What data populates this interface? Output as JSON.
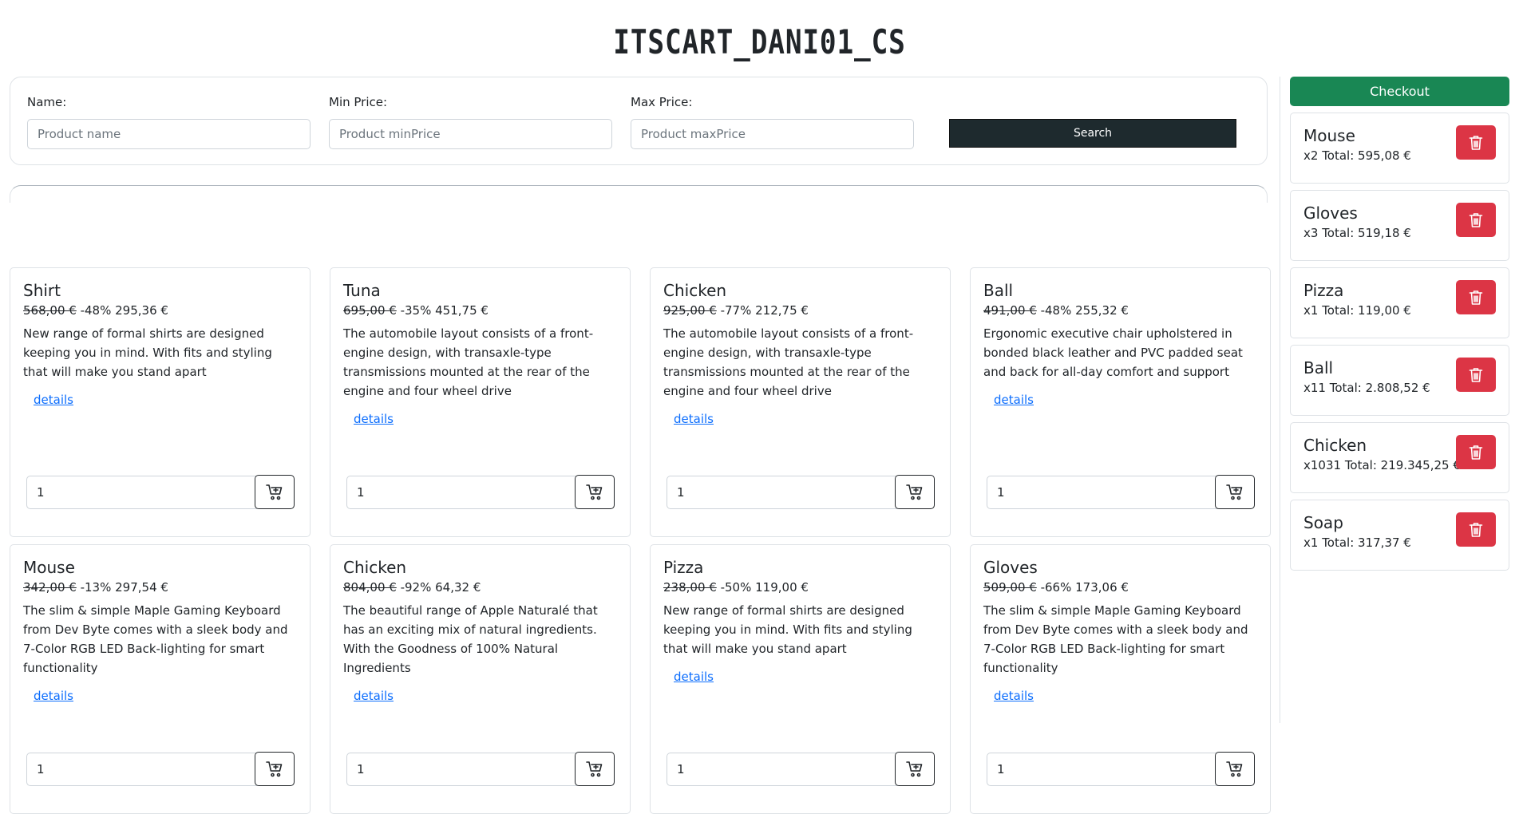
{
  "header": {
    "title": "ITSCART_DANI01_CS"
  },
  "search": {
    "name_label": "Name:",
    "name_placeholder": "Product name",
    "min_label": "Min Price:",
    "min_placeholder": "Product minPrice",
    "max_label": "Max Price:",
    "max_placeholder": "Product maxPrice",
    "button_label": "Search"
  },
  "products": [
    {
      "name": "Shirt",
      "old_price": "568,00 €",
      "discount": "-48%",
      "price": "295,36 €",
      "description": "New range of formal shirts are designed keeping you in mind. With fits and styling that will make you stand apart",
      "details_label": "details",
      "qty": "1"
    },
    {
      "name": "Tuna",
      "old_price": "695,00 €",
      "discount": "-35%",
      "price": "451,75 €",
      "description": "The automobile layout consists of a front-engine design, with transaxle-type transmissions mounted at the rear of the engine and four wheel drive",
      "details_label": "details",
      "qty": "1"
    },
    {
      "name": "Chicken",
      "old_price": "925,00 €",
      "discount": "-77%",
      "price": "212,75 €",
      "description": "The automobile layout consists of a front-engine design, with transaxle-type transmissions mounted at the rear of the engine and four wheel drive",
      "details_label": "details",
      "qty": "1"
    },
    {
      "name": "Ball",
      "old_price": "491,00 €",
      "discount": "-48%",
      "price": "255,32 €",
      "description": "Ergonomic executive chair upholstered in bonded black leather and PVC padded seat and back for all-day comfort and support",
      "details_label": "details",
      "qty": "1"
    },
    {
      "name": "Mouse",
      "old_price": "342,00 €",
      "discount": "-13%",
      "price": "297,54 €",
      "description": "The slim & simple Maple Gaming Keyboard from Dev Byte comes with a sleek body and 7-Color RGB LED Back-lighting for smart functionality",
      "details_label": "details",
      "qty": "1"
    },
    {
      "name": "Chicken",
      "old_price": "804,00 €",
      "discount": "-92%",
      "price": "64,32 €",
      "description": "The beautiful range of Apple Naturalé that has an exciting mix of natural ingredients. With the Goodness of 100% Natural Ingredients",
      "details_label": "details",
      "qty": "1"
    },
    {
      "name": "Pizza",
      "old_price": "238,00 €",
      "discount": "-50%",
      "price": "119,00 €",
      "description": "New range of formal shirts are designed keeping you in mind. With fits and styling that will make you stand apart",
      "details_label": "details",
      "qty": "1"
    },
    {
      "name": "Gloves",
      "old_price": "509,00 €",
      "discount": "-66%",
      "price": "173,06 €",
      "description": "The slim & simple Maple Gaming Keyboard from Dev Byte comes with a sleek body and 7-Color RGB LED Back-lighting for smart functionality",
      "details_label": "details",
      "qty": "1"
    }
  ],
  "cart": {
    "checkout_label": "Checkout",
    "items": [
      {
        "name": "Mouse",
        "summary": "x2 Total: 595,08 €"
      },
      {
        "name": "Gloves",
        "summary": "x3 Total: 519,18 €"
      },
      {
        "name": "Pizza",
        "summary": "x1 Total: 119,00 €"
      },
      {
        "name": "Ball",
        "summary": "x11 Total: 2.808,52 €"
      },
      {
        "name": "Chicken",
        "summary": "x1031 Total: 219.345,25 €"
      },
      {
        "name": "Soap",
        "summary": "x1 Total: 317,37 €"
      }
    ]
  },
  "colors": {
    "checkout": "#198754",
    "delete": "#dc3545",
    "search_button": "#1e2a2e",
    "link": "#0d6efd"
  },
  "icons": {
    "add_to_cart": "cart-plus-icon",
    "delete": "trash-icon"
  }
}
